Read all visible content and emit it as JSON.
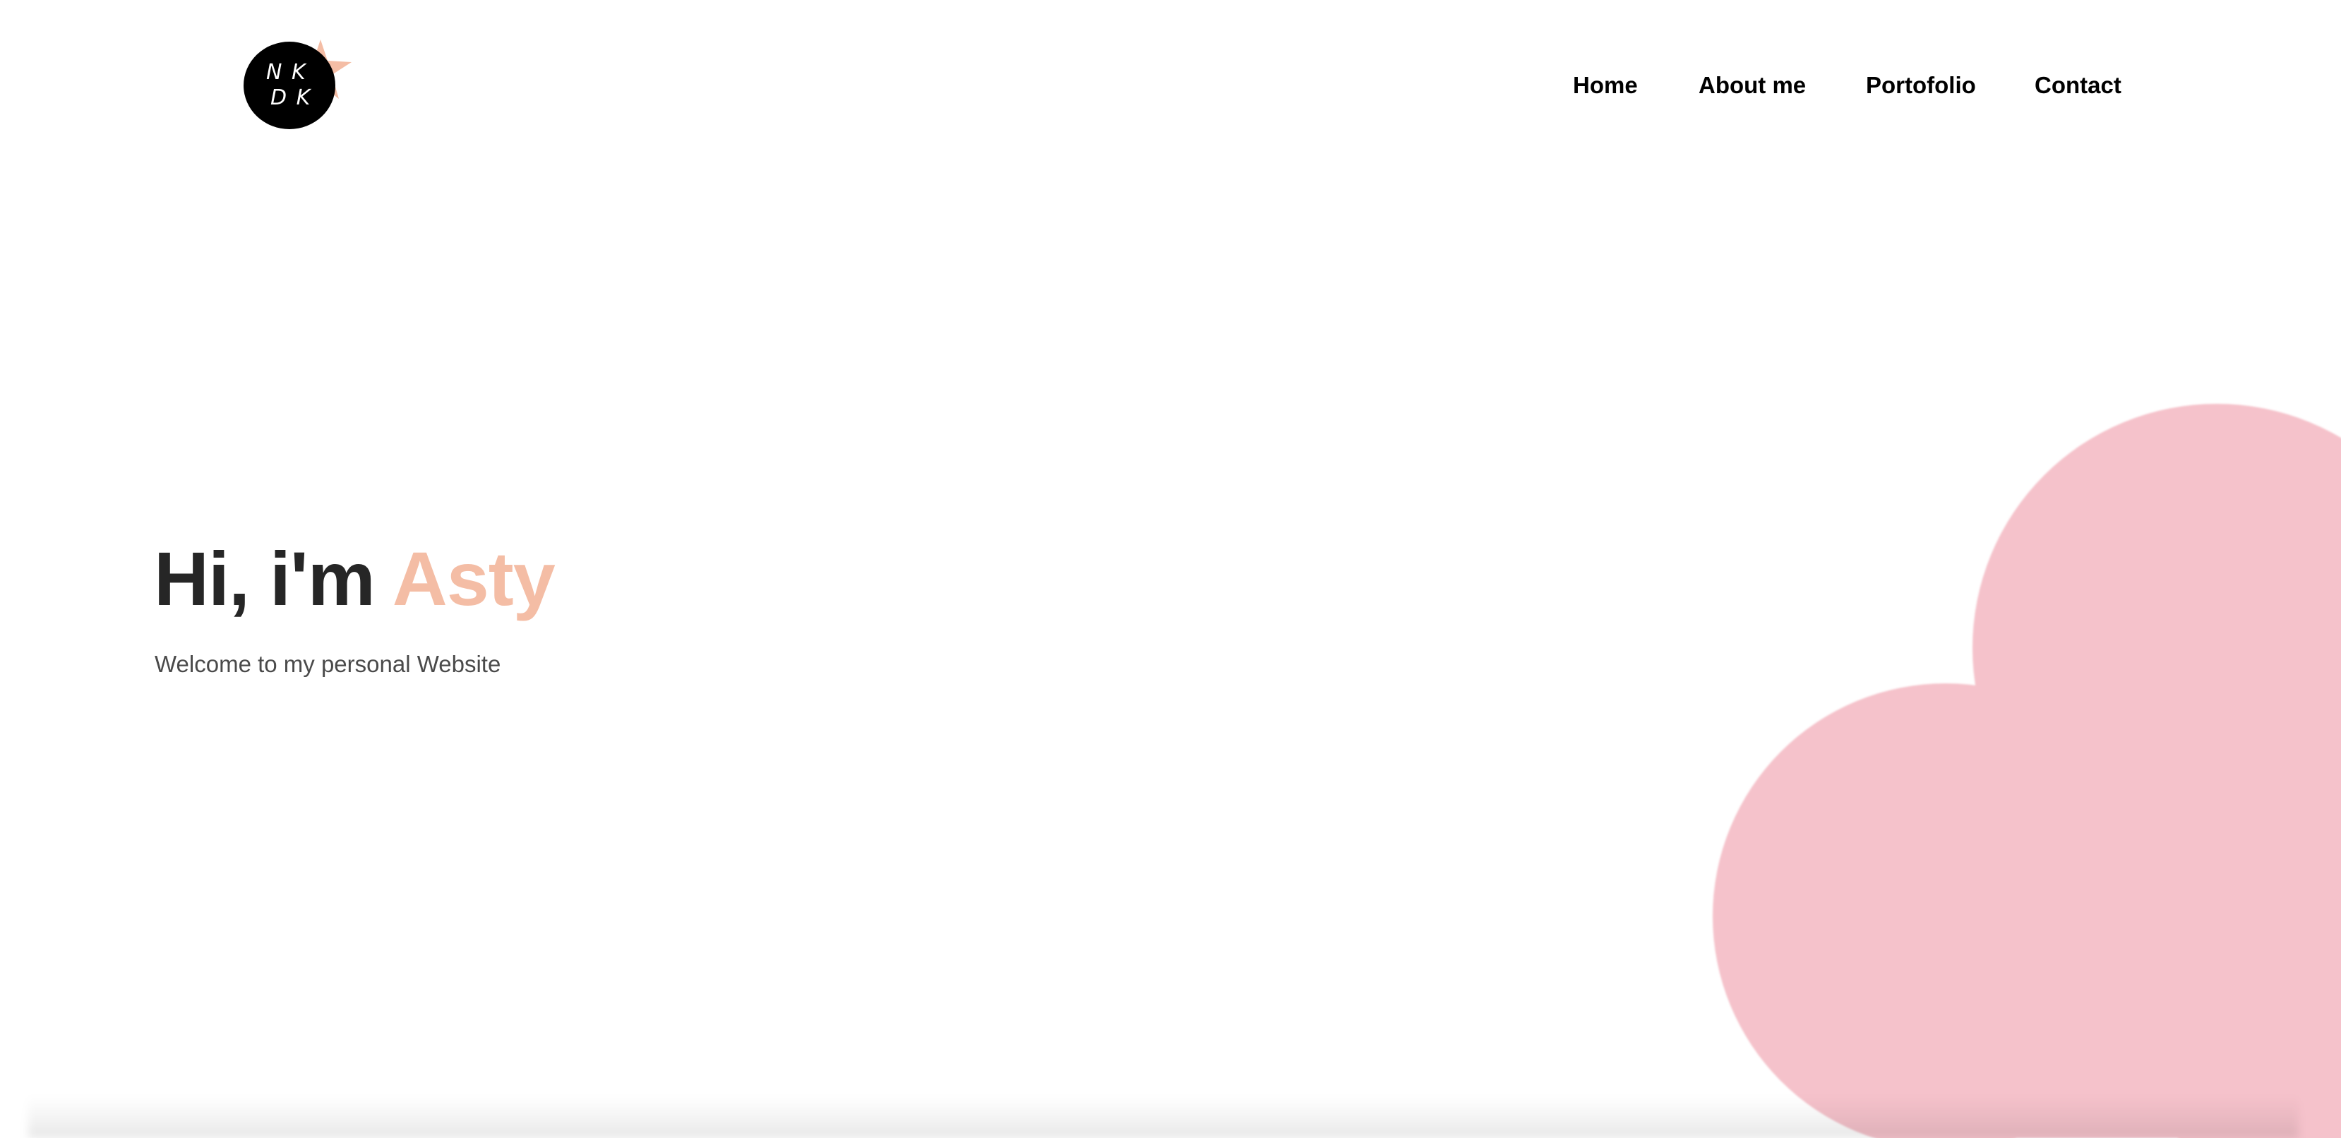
{
  "header": {
    "logo": {
      "text_line1": "N K",
      "text_line2": "D K",
      "circle_color": "#000000",
      "star_color": "#f4bda5"
    },
    "nav": [
      {
        "label": "Home"
      },
      {
        "label": "About me"
      },
      {
        "label": "Portofolio"
      },
      {
        "label": "Contact"
      }
    ]
  },
  "hero": {
    "greeting": "Hi, i'm",
    "name": "Asty",
    "subtitle": "Welcome to my personal Website"
  },
  "colors": {
    "accent": "#f4bda5",
    "cloud": "#f5c2cb",
    "heading": "#262626",
    "body_text": "#4a4a4a",
    "background": "#ffffff"
  }
}
